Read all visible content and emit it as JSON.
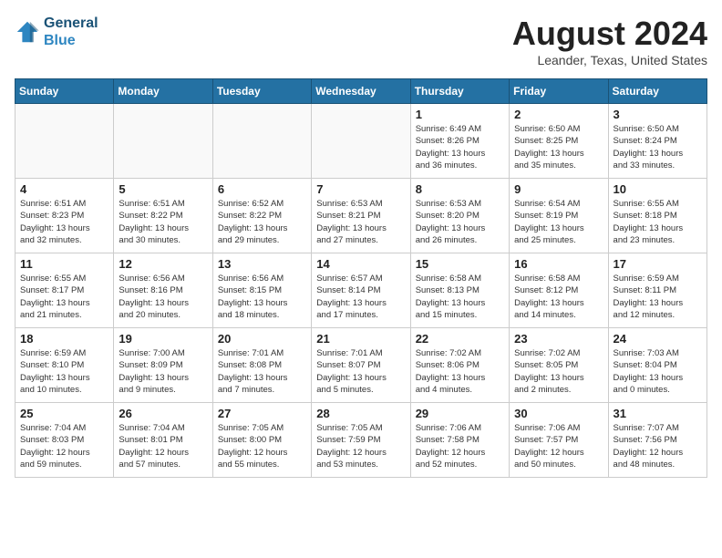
{
  "header": {
    "logo_line1": "General",
    "logo_line2": "Blue",
    "month": "August 2024",
    "location": "Leander, Texas, United States"
  },
  "weekdays": [
    "Sunday",
    "Monday",
    "Tuesday",
    "Wednesday",
    "Thursday",
    "Friday",
    "Saturday"
  ],
  "weeks": [
    [
      {
        "day": "",
        "info": ""
      },
      {
        "day": "",
        "info": ""
      },
      {
        "day": "",
        "info": ""
      },
      {
        "day": "",
        "info": ""
      },
      {
        "day": "1",
        "info": "Sunrise: 6:49 AM\nSunset: 8:26 PM\nDaylight: 13 hours\nand 36 minutes."
      },
      {
        "day": "2",
        "info": "Sunrise: 6:50 AM\nSunset: 8:25 PM\nDaylight: 13 hours\nand 35 minutes."
      },
      {
        "day": "3",
        "info": "Sunrise: 6:50 AM\nSunset: 8:24 PM\nDaylight: 13 hours\nand 33 minutes."
      }
    ],
    [
      {
        "day": "4",
        "info": "Sunrise: 6:51 AM\nSunset: 8:23 PM\nDaylight: 13 hours\nand 32 minutes."
      },
      {
        "day": "5",
        "info": "Sunrise: 6:51 AM\nSunset: 8:22 PM\nDaylight: 13 hours\nand 30 minutes."
      },
      {
        "day": "6",
        "info": "Sunrise: 6:52 AM\nSunset: 8:22 PM\nDaylight: 13 hours\nand 29 minutes."
      },
      {
        "day": "7",
        "info": "Sunrise: 6:53 AM\nSunset: 8:21 PM\nDaylight: 13 hours\nand 27 minutes."
      },
      {
        "day": "8",
        "info": "Sunrise: 6:53 AM\nSunset: 8:20 PM\nDaylight: 13 hours\nand 26 minutes."
      },
      {
        "day": "9",
        "info": "Sunrise: 6:54 AM\nSunset: 8:19 PM\nDaylight: 13 hours\nand 25 minutes."
      },
      {
        "day": "10",
        "info": "Sunrise: 6:55 AM\nSunset: 8:18 PM\nDaylight: 13 hours\nand 23 minutes."
      }
    ],
    [
      {
        "day": "11",
        "info": "Sunrise: 6:55 AM\nSunset: 8:17 PM\nDaylight: 13 hours\nand 21 minutes."
      },
      {
        "day": "12",
        "info": "Sunrise: 6:56 AM\nSunset: 8:16 PM\nDaylight: 13 hours\nand 20 minutes."
      },
      {
        "day": "13",
        "info": "Sunrise: 6:56 AM\nSunset: 8:15 PM\nDaylight: 13 hours\nand 18 minutes."
      },
      {
        "day": "14",
        "info": "Sunrise: 6:57 AM\nSunset: 8:14 PM\nDaylight: 13 hours\nand 17 minutes."
      },
      {
        "day": "15",
        "info": "Sunrise: 6:58 AM\nSunset: 8:13 PM\nDaylight: 13 hours\nand 15 minutes."
      },
      {
        "day": "16",
        "info": "Sunrise: 6:58 AM\nSunset: 8:12 PM\nDaylight: 13 hours\nand 14 minutes."
      },
      {
        "day": "17",
        "info": "Sunrise: 6:59 AM\nSunset: 8:11 PM\nDaylight: 13 hours\nand 12 minutes."
      }
    ],
    [
      {
        "day": "18",
        "info": "Sunrise: 6:59 AM\nSunset: 8:10 PM\nDaylight: 13 hours\nand 10 minutes."
      },
      {
        "day": "19",
        "info": "Sunrise: 7:00 AM\nSunset: 8:09 PM\nDaylight: 13 hours\nand 9 minutes."
      },
      {
        "day": "20",
        "info": "Sunrise: 7:01 AM\nSunset: 8:08 PM\nDaylight: 13 hours\nand 7 minutes."
      },
      {
        "day": "21",
        "info": "Sunrise: 7:01 AM\nSunset: 8:07 PM\nDaylight: 13 hours\nand 5 minutes."
      },
      {
        "day": "22",
        "info": "Sunrise: 7:02 AM\nSunset: 8:06 PM\nDaylight: 13 hours\nand 4 minutes."
      },
      {
        "day": "23",
        "info": "Sunrise: 7:02 AM\nSunset: 8:05 PM\nDaylight: 13 hours\nand 2 minutes."
      },
      {
        "day": "24",
        "info": "Sunrise: 7:03 AM\nSunset: 8:04 PM\nDaylight: 13 hours\nand 0 minutes."
      }
    ],
    [
      {
        "day": "25",
        "info": "Sunrise: 7:04 AM\nSunset: 8:03 PM\nDaylight: 12 hours\nand 59 minutes."
      },
      {
        "day": "26",
        "info": "Sunrise: 7:04 AM\nSunset: 8:01 PM\nDaylight: 12 hours\nand 57 minutes."
      },
      {
        "day": "27",
        "info": "Sunrise: 7:05 AM\nSunset: 8:00 PM\nDaylight: 12 hours\nand 55 minutes."
      },
      {
        "day": "28",
        "info": "Sunrise: 7:05 AM\nSunset: 7:59 PM\nDaylight: 12 hours\nand 53 minutes."
      },
      {
        "day": "29",
        "info": "Sunrise: 7:06 AM\nSunset: 7:58 PM\nDaylight: 12 hours\nand 52 minutes."
      },
      {
        "day": "30",
        "info": "Sunrise: 7:06 AM\nSunset: 7:57 PM\nDaylight: 12 hours\nand 50 minutes."
      },
      {
        "day": "31",
        "info": "Sunrise: 7:07 AM\nSunset: 7:56 PM\nDaylight: 12 hours\nand 48 minutes."
      }
    ]
  ]
}
